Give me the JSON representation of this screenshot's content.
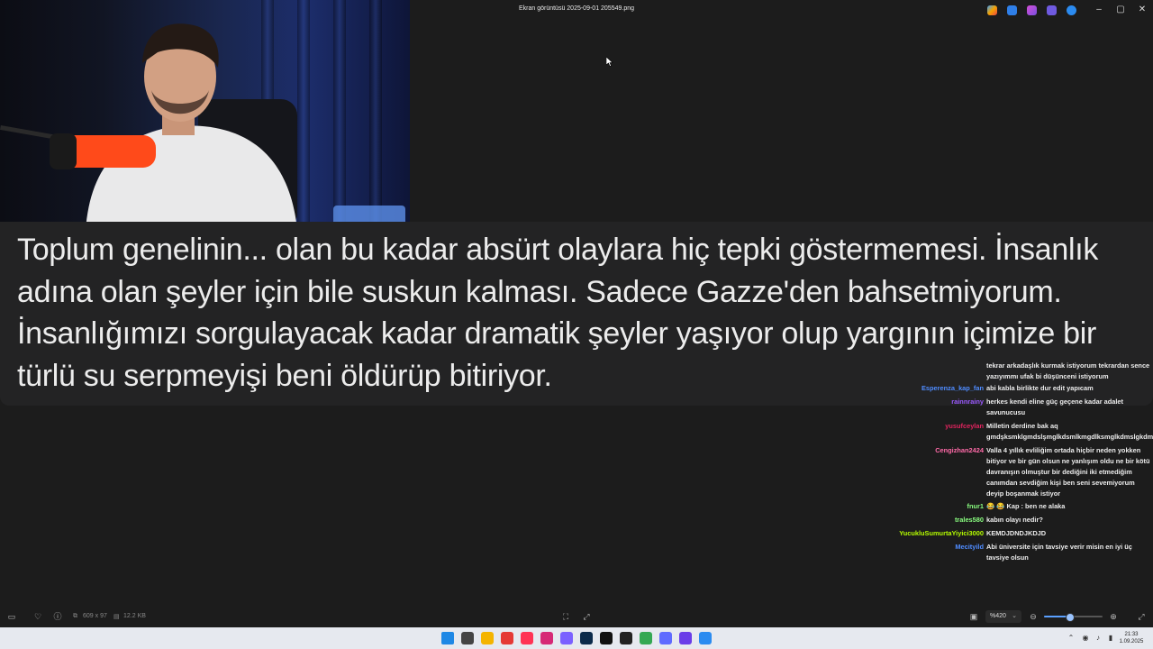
{
  "window": {
    "title": "Ekran görüntüsü 2025-09-01 205549.png",
    "controls": {
      "minimize": "–",
      "maximize": "▢",
      "close": "✕"
    }
  },
  "subtitle": {
    "text": "Toplum genelinin... olan bu kadar absürt olaylara hiç tepki göstermemesi. İnsanlık adına olan şeyler için bile suskun kalması. Sadece Gazze'den bahsetmiyorum. İnsanlığımızı sorgulayacak kadar dramatik şeyler yaşıyor olup yargının içimize bir türlü su serpmeyişi beni öldürüp bitiriyor."
  },
  "chat": [
    {
      "user": "",
      "message": "tekrar arkadaşlık kurmak istiyorum tekrardan sence yazıyımmı ufak bi düşünceni istiyorum",
      "color": "#ececec"
    },
    {
      "user": "Esperenza_kap_fan",
      "message": "abi kabla birlikte dur edit yapıcam",
      "color": "#4f8cff"
    },
    {
      "user": "rainnrainy",
      "message": "herkes kendi eline güç geçene kadar adalet savunucusu",
      "color": "#9b59ff"
    },
    {
      "user": "yusufceylan",
      "message": "Milletin derdine bak aq gmdşksmklgmdslşmglkdsmlkmgdlksmglkdmslgkdmlsk",
      "color": "#e0245e"
    },
    {
      "user": "Cengizhan2424",
      "message": "Valla 4 yıllık evliliğim ortada hiçbir neden yokken bitiyor ve bir gün olsun ne yanlışım oldu ne bir kötü davranışın olmuştur bir dediğini iki etmediğim canımdan sevdiğim kişi ben seni sevemiyorum deyip boşanmak istiyor",
      "color": "#ff6aa8"
    },
    {
      "user": "fnur1",
      "message": "😂 😂 Kap : ben ne alaka",
      "color": "#8aff80"
    },
    {
      "user": "trales580",
      "message": "kabın olayı nedir?",
      "color": "#8aff80"
    },
    {
      "user": "YucukluSumurtaYiyici3000",
      "message": "KEMDJDNDJKDJD",
      "color": "#b6ff00"
    },
    {
      "user": "Mecityild",
      "message": "Abi üniversite için tavsiye verir misin en iyi üç tavsiye olsun",
      "color": "#4f8cff"
    }
  ],
  "statusbar": {
    "dimensions": "609 x 97",
    "filesize": "12.2 KB",
    "zoom": "%420",
    "zoom_level": 0.45
  },
  "taskbar": {
    "time": "21:33",
    "date": "1.09.2025"
  },
  "icons": {
    "tray_apps": [
      "copilot-icon",
      "photos-icon",
      "paint-icon",
      "teams-icon",
      "onedrive-icon"
    ],
    "taskbar_apps": [
      "start-icon",
      "task-view-icon",
      "file-explorer-icon",
      "chrome-icon",
      "opera-icon",
      "instagram-icon",
      "messenger-icon",
      "photoshop-icon",
      "tiktok-icon",
      "capcut-icon",
      "chrome-icon",
      "snipping-icon",
      "obs-icon",
      "photos-icon"
    ]
  }
}
